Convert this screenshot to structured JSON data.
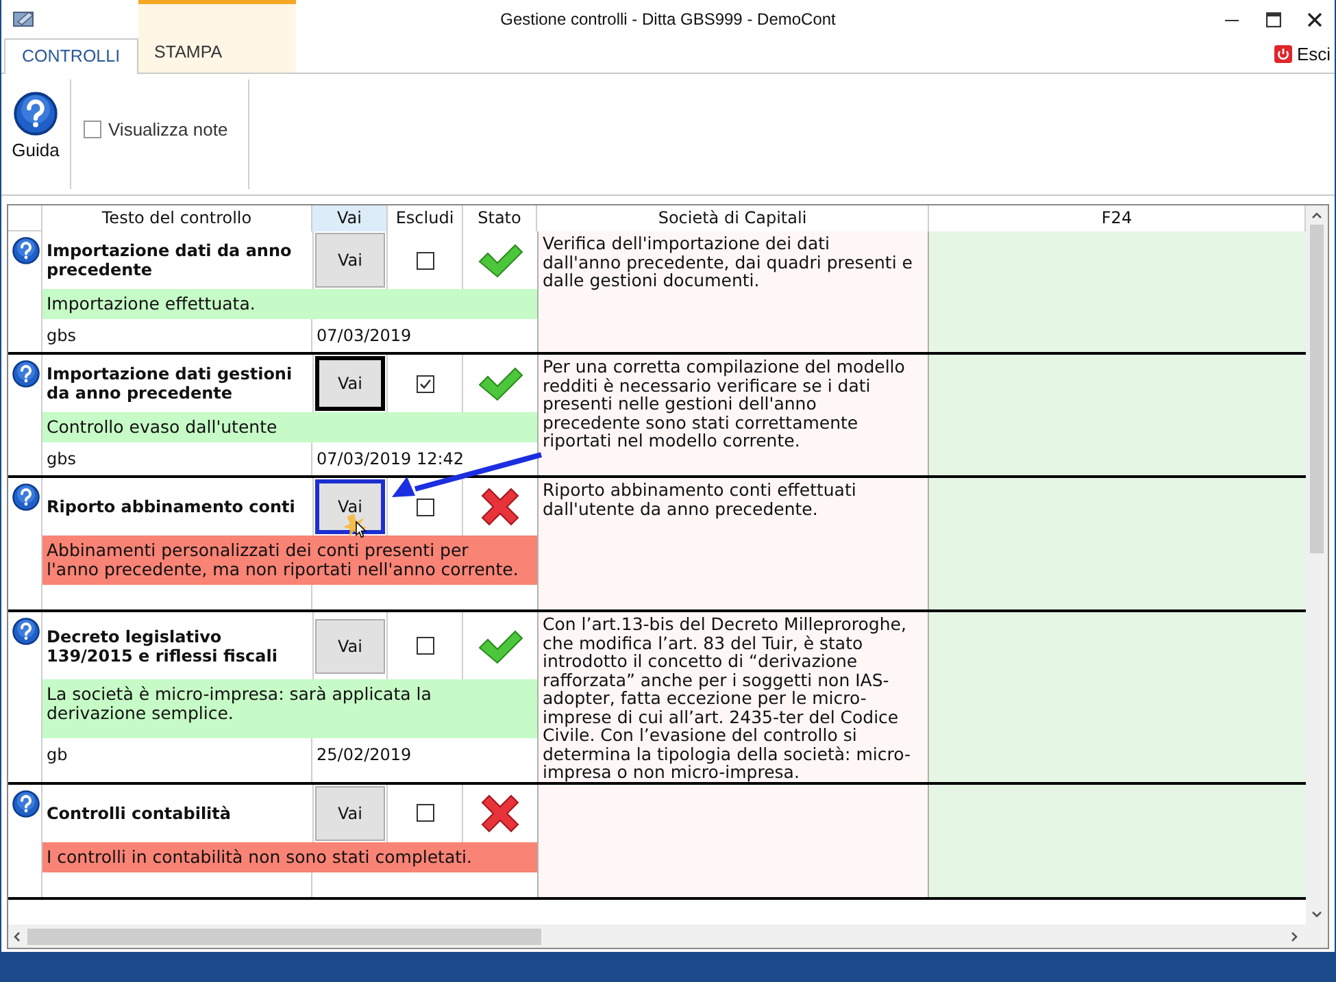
{
  "window": {
    "title": "Gestione controlli - Ditta GBS999 - DemoCont"
  },
  "tabs": [
    {
      "label": "CONTROLLI",
      "selected": true,
      "kind": "normal"
    },
    {
      "label": "STAMPA",
      "selected": false,
      "kind": "contextual"
    }
  ],
  "exit_button": "Esci",
  "ribbon": {
    "help_label": "Guida",
    "notes": {
      "label": "Visualizza note",
      "checked": false
    }
  },
  "table": {
    "columns": [
      {
        "label": "Testo del controllo",
        "selected": false
      },
      {
        "label": "Vai",
        "selected": true
      },
      {
        "label": "Escludi",
        "selected": false
      },
      {
        "label": "Stato",
        "selected": false
      },
      {
        "label": "Società di Capitali",
        "selected": false
      },
      {
        "label": "F24",
        "selected": false
      }
    ],
    "rows": [
      {
        "title": "Importazione dati da anno precedente",
        "button": "Vai",
        "focused": false,
        "highlighted": false,
        "excluded": false,
        "done": true,
        "message": "Importazione effettuata.",
        "user": "gbs",
        "date": "07/03/2019",
        "description": "Verifica dell'importazione dei dati dall'anno precedente, dai quadri presenti e dalle gestioni documenti."
      },
      {
        "title": "Importazione dati gestioni da anno precedente",
        "button": "Vai",
        "focused": true,
        "highlighted": false,
        "excluded": true,
        "done": true,
        "message": "Controllo evaso dall'utente",
        "user": "gbs",
        "date": "07/03/2019 12:42",
        "description": "Per una corretta compilazione del modello redditi è necessario verificare se i dati presenti nelle gestioni dell'anno precedente sono stati correttamente riportati nel modello corrente."
      },
      {
        "title": "Riporto abbinamento conti",
        "button": "Vai",
        "focused": false,
        "highlighted": true,
        "excluded": false,
        "done": false,
        "message": "Abbinamenti personalizzati dei conti presenti per l'anno precedente, ma non riportati nell'anno corrente.",
        "description": "Riporto abbinamento conti effettuati dall'utente da anno precedente."
      },
      {
        "title": "Decreto legislativo 139/2015 e riflessi fiscali",
        "button": "Vai",
        "focused": false,
        "highlighted": false,
        "excluded": false,
        "done": true,
        "message": "La società è micro-impresa: sarà applicata la derivazione semplice.",
        "user": "gb",
        "date": "25/02/2019",
        "description": "Con l’art.13-bis del Decreto Milleproroghe, che modifica l’art. 83 del Tuir, è stato introdotto il concetto di “derivazione rafforzata” anche per i soggetti non IAS-adopter, fatta eccezione per le micro-imprese di cui all’art. 2435-ter del Codice Civile. Con l’evasione del controllo si determina la tipologia della società: micro-impresa o non micro-impresa."
      },
      {
        "title": "Controlli contabilità",
        "button": "Vai",
        "focused": false,
        "highlighted": false,
        "excluded": false,
        "done": false,
        "message": "I controlli in contabilità non sono stati completati."
      }
    ]
  }
}
